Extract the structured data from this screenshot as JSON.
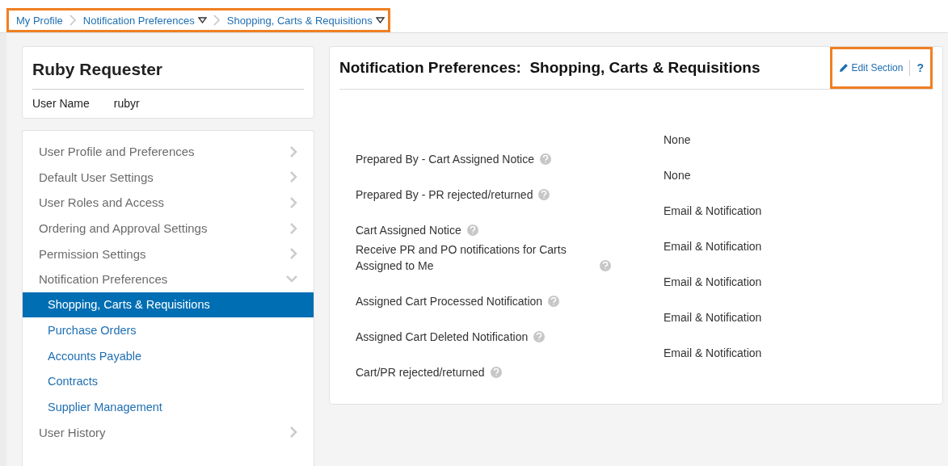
{
  "breadcrumb": {
    "highlighted": true,
    "items": [
      {
        "label": "My Profile",
        "dropdown": false
      },
      {
        "label": "Notification Preferences",
        "dropdown": true
      },
      {
        "label": "Shopping, Carts & Requisitions",
        "dropdown": true
      }
    ]
  },
  "profile": {
    "name": "Ruby Requester",
    "field_label": "User Name",
    "field_value": "rubyr"
  },
  "nav": [
    {
      "label": "User Profile and Preferences",
      "expanded": false
    },
    {
      "label": "Default User Settings",
      "expanded": false
    },
    {
      "label": "User Roles and Access",
      "expanded": false
    },
    {
      "label": "Ordering and Approval Settings",
      "expanded": false
    },
    {
      "label": "Permission Settings",
      "expanded": false
    },
    {
      "label": "Notification Preferences",
      "expanded": true,
      "children": [
        {
          "label": "Shopping, Carts & Requisitions",
          "selected": true
        },
        {
          "label": "Purchase Orders",
          "selected": false
        },
        {
          "label": "Accounts Payable",
          "selected": false
        },
        {
          "label": "Contracts",
          "selected": false
        },
        {
          "label": "Supplier Management",
          "selected": false
        }
      ]
    },
    {
      "label": "User History",
      "expanded": false
    }
  ],
  "section": {
    "title": "Notification Preferences:  Shopping, Carts & Requisitions",
    "actions_highlighted": true,
    "edit_label": "Edit Section",
    "help_label": "?",
    "rows": [
      {
        "label": "Prepared By - Cart Assigned Notice",
        "value": "None"
      },
      {
        "label": "Prepared By - PR rejected/returned",
        "value": "None"
      },
      {
        "label": "Cart Assigned Notice",
        "value": "Email & Notification"
      },
      {
        "label": "Receive PR and PO notifications for Carts Assigned to Me",
        "value": "Email & Notification"
      },
      {
        "label": "Assigned Cart Processed Notification",
        "value": "Email & Notification"
      },
      {
        "label": "Assigned Cart Deleted Notification",
        "value": "Email & Notification"
      },
      {
        "label": "Cart/PR rejected/returned",
        "value": "Email & Notification"
      }
    ]
  }
}
